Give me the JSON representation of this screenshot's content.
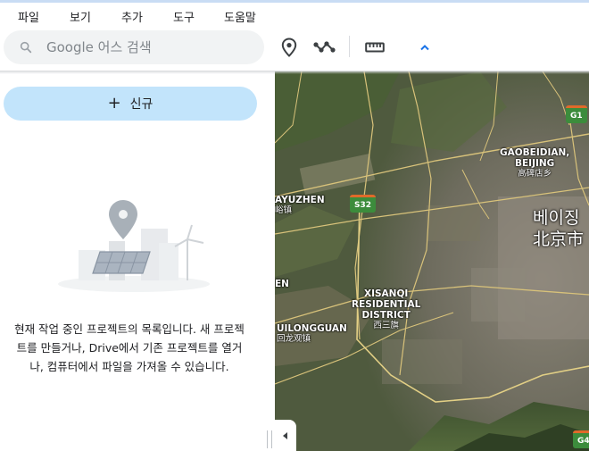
{
  "menu": [
    "파일",
    "보기",
    "추가",
    "도구",
    "도움말"
  ],
  "search": {
    "placeholder": "Google 어스 검색"
  },
  "toolbar": {
    "placemark_icon": "placemark-icon",
    "path_icon": "draw-path-icon",
    "measure_icon": "ruler-icon",
    "collapse_icon": "chevron-up-icon"
  },
  "sidebar": {
    "new_button_label": "신규",
    "empty_message": "현재 작업 중인 프로젝트의 목록입니다. 새 프로젝트를 만들거나, Drive에서 기존 프로젝트를 열거나, 컴퓨터에서 파일을 가져올 수 있습니다."
  },
  "map": {
    "labels": [
      {
        "name": "GAOBEIDIAN, BEIJING",
        "line1": "GAOBEIDIAN,",
        "line2": "BEIJING",
        "cn": "高碑店乡"
      },
      {
        "name": "YAYUZHEN",
        "line1": "AYUZHEN",
        "cn": "峪镇"
      },
      {
        "name": "XISANQI RESIDENTIAL DISTRICT",
        "line1": "XISANQI",
        "line2": "RESIDENTIAL",
        "line3": "DISTRICT",
        "cn": "西三旗"
      },
      {
        "name": "HUILONGGUAN",
        "line1": "UILONGGUAN",
        "cn": "回龙观镇"
      },
      {
        "name": "EN",
        "line1": "EN"
      }
    ],
    "city": {
      "ko": "베이징",
      "cn": "北京市"
    },
    "shields": [
      "G1",
      "S32",
      "G4"
    ]
  }
}
